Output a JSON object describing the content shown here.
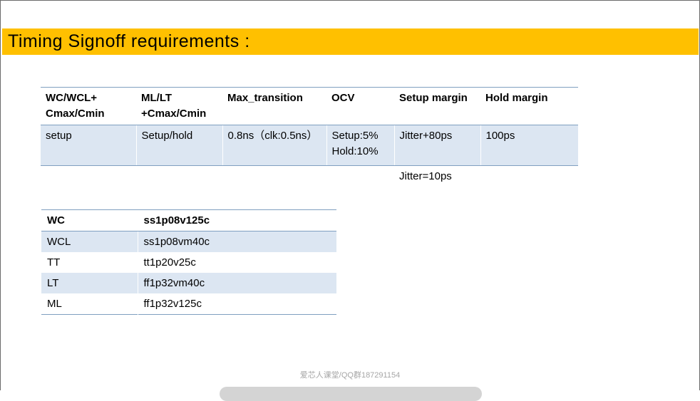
{
  "title": "Timing Signoff requirements :",
  "table1": {
    "headers": [
      [
        "WC/WCL+",
        "Cmax/Cmin"
      ],
      [
        "ML/LT",
        "+Cmax/Cmin"
      ],
      [
        "Max_transition"
      ],
      [
        "OCV"
      ],
      [
        "Setup margin"
      ],
      [
        "Hold margin"
      ]
    ],
    "row1": [
      [
        "setup"
      ],
      [
        "Setup/hold"
      ],
      [
        "0.8ns（clk:0.5ns）"
      ],
      [
        "Setup:5%",
        "Hold:10%"
      ],
      [
        "Jitter+80ps"
      ],
      [
        "100ps"
      ]
    ],
    "row2_setup_margin": "Jitter=10ps"
  },
  "table2": {
    "rows": [
      [
        "WC",
        "ss1p08v125c"
      ],
      [
        "WCL",
        "ss1p08vm40c"
      ],
      [
        "TT",
        "tt1p20v25c"
      ],
      [
        "LT",
        "ff1p32vm40c"
      ],
      [
        "ML",
        "ff1p32v125c"
      ]
    ]
  },
  "watermark": "爱芯人课堂/QQ群187291154",
  "colors": {
    "banner": "#ffc000",
    "row_band": "#dce6f2",
    "rule": "#7f9fc0"
  }
}
